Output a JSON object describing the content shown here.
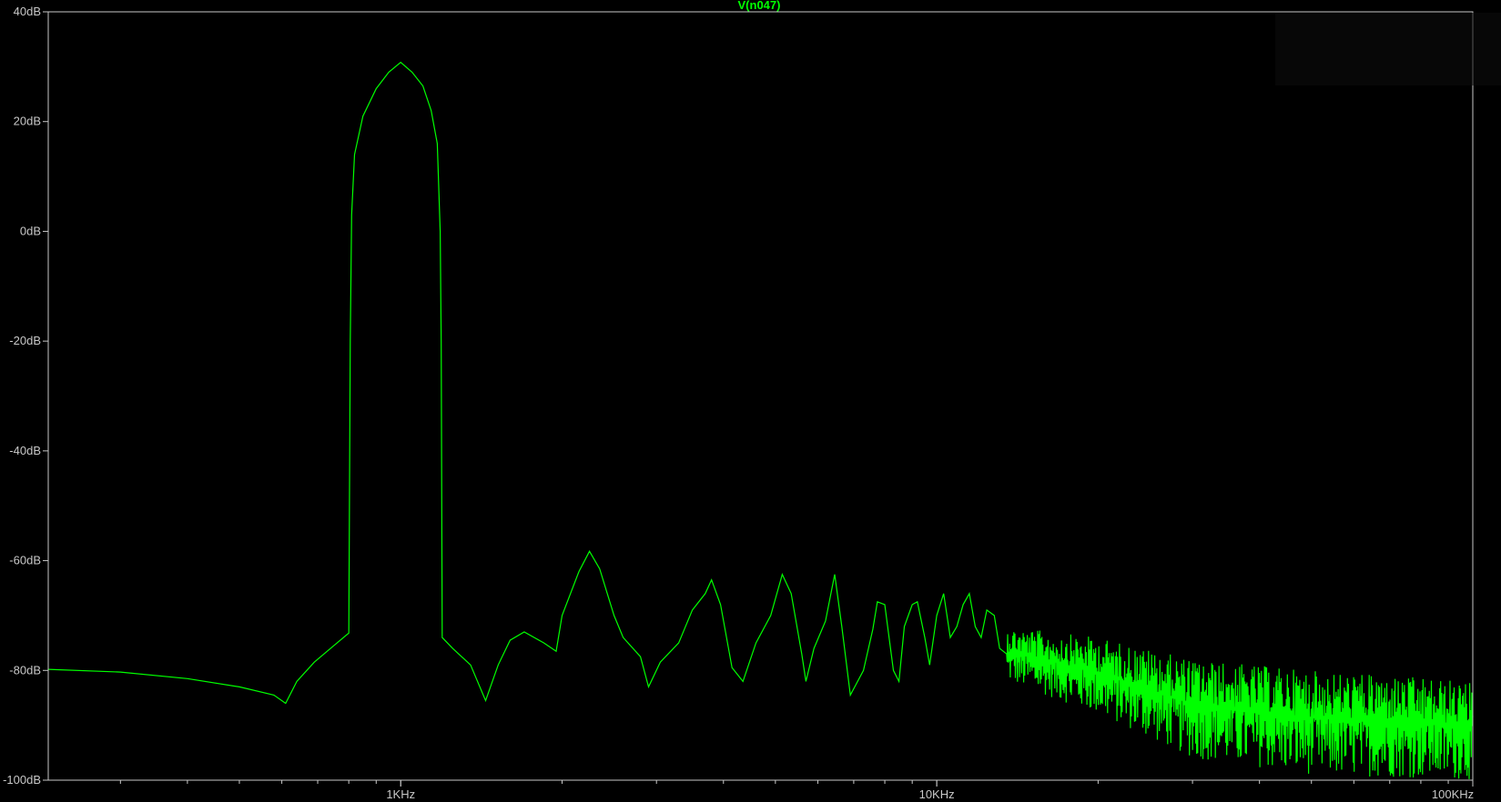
{
  "colors": {
    "background": "#000000",
    "trace": "#00ff00",
    "frame": "#c8c8c8",
    "tick_text": "#c8c8c8",
    "title": "#00ff00"
  },
  "chart_data": {
    "type": "line",
    "title": "",
    "grid": false,
    "x_scale": "log",
    "y_scale": "linear",
    "xlim_hz": [
      220,
      100000
    ],
    "ylim_db": [
      -100,
      40
    ],
    "x_ticks": [
      {
        "value": 1000,
        "label": "1KHz"
      },
      {
        "value": 10000,
        "label": "10KHz"
      },
      {
        "value": 100000,
        "label": "100KHz"
      }
    ],
    "y_ticks": [
      {
        "value": 40,
        "label": "40dB"
      },
      {
        "value": 20,
        "label": "20dB"
      },
      {
        "value": 0,
        "label": "0dB"
      },
      {
        "value": -20,
        "label": "-20dB"
      },
      {
        "value": -40,
        "label": "-40dB"
      },
      {
        "value": -60,
        "label": "-60dB"
      },
      {
        "value": -80,
        "label": "-80dB"
      },
      {
        "value": -100,
        "label": "-100dB"
      }
    ],
    "series": [
      {
        "name": "V(n047)",
        "x_units": "Hz",
        "y_units": "dB",
        "noise_floor": {
          "x_start_hz": 13500,
          "x_end_hz": 100000,
          "note": "dense noise region; min/max envelope in dB at log-spaced frequencies",
          "envelope": [
            {
              "x": 13500,
              "min": -82,
              "max": -72
            },
            {
              "x": 20000,
              "min": -88,
              "max": -74
            },
            {
              "x": 30000,
              "min": -96,
              "max": -78
            },
            {
              "x": 50000,
              "min": -99,
              "max": -80
            },
            {
              "x": 100000,
              "min": -100,
              "max": -82
            }
          ]
        },
        "points": [
          [
            220,
            -79.8
          ],
          [
            300,
            -80.3
          ],
          [
            400,
            -81.5
          ],
          [
            500,
            -83.0
          ],
          [
            580,
            -84.5
          ],
          [
            610,
            -86.0
          ],
          [
            640,
            -82.0
          ],
          [
            690,
            -78.5
          ],
          [
            750,
            -75.5
          ],
          [
            800,
            -73.2
          ],
          [
            805,
            -20.0
          ],
          [
            810,
            3.0
          ],
          [
            820,
            14.0
          ],
          [
            850,
            21.0
          ],
          [
            900,
            26.0
          ],
          [
            950,
            29.0
          ],
          [
            1000,
            30.8
          ],
          [
            1050,
            29.0
          ],
          [
            1100,
            26.5
          ],
          [
            1140,
            22.0
          ],
          [
            1170,
            16.0
          ],
          [
            1185,
            0.0
          ],
          [
            1190,
            -20.0
          ],
          [
            1195,
            -74.0
          ],
          [
            1250,
            -76.0
          ],
          [
            1350,
            -79.0
          ],
          [
            1440,
            -85.5
          ],
          [
            1520,
            -79.0
          ],
          [
            1600,
            -74.5
          ],
          [
            1700,
            -73.0
          ],
          [
            1850,
            -75.0
          ],
          [
            1950,
            -76.5
          ],
          [
            2000,
            -70.0
          ],
          [
            2150,
            -62.0
          ],
          [
            2250,
            -58.3
          ],
          [
            2350,
            -61.5
          ],
          [
            2500,
            -70.0
          ],
          [
            2600,
            -74.0
          ],
          [
            2800,
            -77.5
          ],
          [
            2900,
            -83.0
          ],
          [
            3050,
            -78.5
          ],
          [
            3300,
            -75.0
          ],
          [
            3500,
            -69.0
          ],
          [
            3700,
            -66.0
          ],
          [
            3800,
            -63.5
          ],
          [
            3950,
            -68.0
          ],
          [
            4150,
            -79.5
          ],
          [
            4350,
            -82.0
          ],
          [
            4600,
            -75.0
          ],
          [
            4900,
            -70.0
          ],
          [
            5150,
            -62.5
          ],
          [
            5350,
            -66.0
          ],
          [
            5600,
            -77.0
          ],
          [
            5700,
            -82.0
          ],
          [
            5900,
            -76.0
          ],
          [
            6200,
            -71.0
          ],
          [
            6450,
            -62.5
          ],
          [
            6650,
            -72.0
          ],
          [
            6900,
            -84.5
          ],
          [
            7300,
            -80.0
          ],
          [
            7600,
            -72.5
          ],
          [
            7750,
            -67.5
          ],
          [
            8000,
            -68.0
          ],
          [
            8300,
            -80.0
          ],
          [
            8500,
            -82.0
          ],
          [
            8700,
            -72.0
          ],
          [
            9000,
            -68.0
          ],
          [
            9200,
            -67.5
          ],
          [
            9500,
            -74.0
          ],
          [
            9700,
            -79.0
          ],
          [
            10000,
            -70.0
          ],
          [
            10300,
            -66.0
          ],
          [
            10600,
            -74.0
          ],
          [
            10900,
            -72.0
          ],
          [
            11200,
            -68.0
          ],
          [
            11500,
            -66.0
          ],
          [
            11800,
            -72.0
          ],
          [
            12100,
            -74.0
          ],
          [
            12400,
            -69.0
          ],
          [
            12800,
            -70.0
          ],
          [
            13100,
            -76.0
          ],
          [
            13500,
            -77.0
          ]
        ]
      }
    ]
  }
}
